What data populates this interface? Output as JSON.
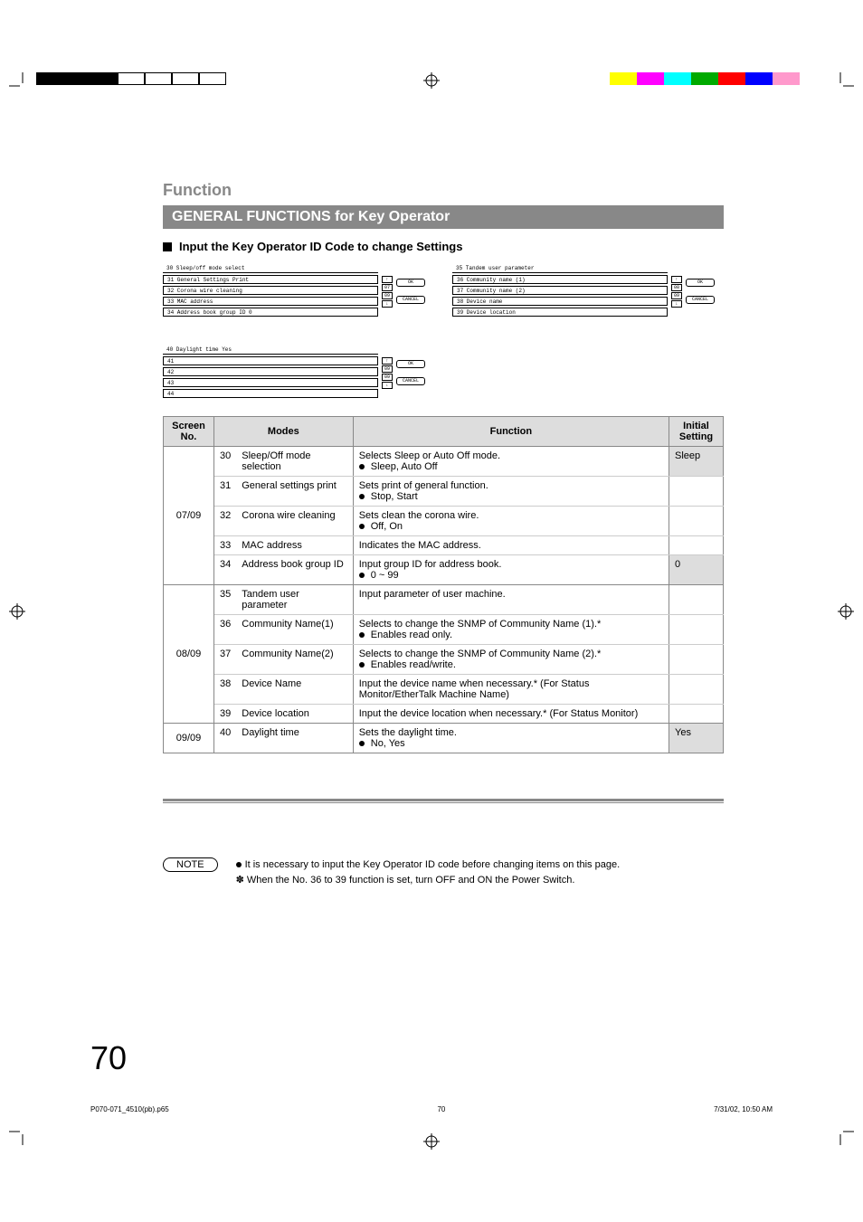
{
  "section_title": "Function",
  "banner": "GENERAL FUNCTIONS for Key Operator",
  "subhead": "Input the Key Operator ID Code to change Settings",
  "screen_panels": [
    {
      "page_indicator": [
        "07",
        "09"
      ],
      "rows": [
        {
          "n": "30",
          "label": "Sleep/off mode select",
          "val": ""
        },
        {
          "n": "31",
          "label": "General Settings Print",
          "val": ""
        },
        {
          "n": "32",
          "label": "Corona wire cleaning",
          "val": ""
        },
        {
          "n": "33",
          "label": "MAC address",
          "val": ""
        },
        {
          "n": "34",
          "label": "Address book group ID",
          "val": "0"
        }
      ],
      "ok": "OK",
      "cancel": "CANCEL"
    },
    {
      "page_indicator": [
        "08",
        "09"
      ],
      "rows": [
        {
          "n": "35",
          "label": "Tandem user parameter",
          "val": ""
        },
        {
          "n": "36",
          "label": "Community name (1)",
          "val": ""
        },
        {
          "n": "37",
          "label": "Community name (2)",
          "val": ""
        },
        {
          "n": "38",
          "label": "Device name",
          "val": ""
        },
        {
          "n": "39",
          "label": "Device location",
          "val": ""
        }
      ],
      "ok": "OK",
      "cancel": "CANCEL"
    },
    {
      "page_indicator": [
        "09",
        "09"
      ],
      "rows": [
        {
          "n": "40",
          "label": "Daylight time",
          "val": "Yes"
        },
        {
          "n": "41",
          "label": "",
          "val": ""
        },
        {
          "n": "42",
          "label": "",
          "val": ""
        },
        {
          "n": "43",
          "label": "",
          "val": ""
        },
        {
          "n": "44",
          "label": "",
          "val": ""
        }
      ],
      "ok": "OK",
      "cancel": "CANCEL"
    }
  ],
  "table": {
    "headers": {
      "screen": "Screen No.",
      "modes": "Modes",
      "function": "Function",
      "initial": "Initial Setting"
    },
    "groups": [
      {
        "screen_no": "07/09",
        "rows": [
          {
            "n": "30",
            "mode": "Sleep/Off mode selection",
            "fn": "Selects Sleep or Auto Off mode.",
            "opts": "Sleep, Auto Off",
            "initial": "Sleep",
            "shade": true
          },
          {
            "n": "31",
            "mode": "General settings print",
            "fn": "Sets print of general function.",
            "opts": "Stop, Start",
            "initial": "",
            "shade": false
          },
          {
            "n": "32",
            "mode": "Corona wire cleaning",
            "fn": "Sets clean the corona wire.",
            "opts": "Off, On",
            "initial": "",
            "shade": false
          },
          {
            "n": "33",
            "mode": "MAC address",
            "fn": "Indicates the MAC address.",
            "opts": "",
            "initial": "",
            "shade": false
          },
          {
            "n": "34",
            "mode": "Address book group ID",
            "fn": "Input group ID for address book.",
            "opts": "0 ~ 99",
            "initial": "0",
            "shade": true
          }
        ]
      },
      {
        "screen_no": "08/09",
        "rows": [
          {
            "n": "35",
            "mode": "Tandem user parameter",
            "fn": "Input parameter of user machine.",
            "opts": "",
            "initial": "",
            "shade": false
          },
          {
            "n": "36",
            "mode": "Community Name(1)",
            "fn": "Selects to change the SNMP of Community Name (1).*",
            "opts": "Enables read only.",
            "initial": "",
            "shade": false
          },
          {
            "n": "37",
            "mode": "Community Name(2)",
            "fn": "Selects to change the SNMP of Community Name (2).*",
            "opts": "Enables read/write.",
            "initial": "",
            "shade": false
          },
          {
            "n": "38",
            "mode": "Device Name",
            "fn": "Input the device name when necessary.* (For Status Monitor/EtherTalk Machine Name)",
            "opts": "",
            "initial": "",
            "shade": false
          },
          {
            "n": "39",
            "mode": "Device location",
            "fn": "Input the device location when necessary.* (For Status Monitor)",
            "opts": "",
            "initial": "",
            "shade": false
          }
        ]
      },
      {
        "screen_no": "09/09",
        "rows": [
          {
            "n": "40",
            "mode": "Daylight time",
            "fn": "Sets the daylight time.",
            "opts": "No, Yes",
            "initial": "Yes",
            "shade": true
          }
        ]
      }
    ]
  },
  "note_label": "NOTE",
  "note_lines": [
    "It is necessary to input the Key Operator ID code before changing items on this page.",
    "When the No. 36 to 39 function is set, turn OFF and ON the Power Switch."
  ],
  "page_number": "70",
  "footer_left": "P070-071_4510(pb).p65",
  "footer_mid": "70",
  "footer_right": "7/31/02, 10:50 AM",
  "reg_colors_bw": [
    "#000",
    "#000",
    "#000",
    "#fff",
    "#fff",
    "#fff",
    "#fff"
  ],
  "reg_colors_color": [
    "#ff0",
    "#f0f",
    "#0ff",
    "#0a0",
    "#f00",
    "#00f",
    "#f9c",
    "#fff"
  ]
}
